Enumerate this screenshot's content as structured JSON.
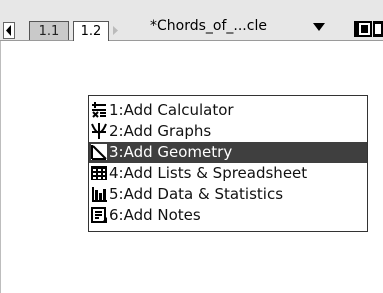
{
  "tabs": [
    {
      "label": "1.1"
    },
    {
      "label": "1.2"
    }
  ],
  "document": {
    "title": "*Chords_of_...cle"
  },
  "menu": {
    "items": [
      {
        "label": "1:Add Calculator",
        "icon": "calculator-icon"
      },
      {
        "label": "2:Add Graphs",
        "icon": "graphs-icon"
      },
      {
        "label": "3:Add Geometry",
        "icon": "geometry-icon",
        "selected": true
      },
      {
        "label": "4:Add Lists & Spreadsheet",
        "icon": "spreadsheet-icon"
      },
      {
        "label": "5:Add Data & Statistics",
        "icon": "statistics-icon"
      },
      {
        "label": "6:Add Notes",
        "icon": "notes-icon"
      }
    ]
  },
  "colors": {
    "selected_bg": "#3f3f3f",
    "tabbar_bg": "#e7e7e7"
  }
}
